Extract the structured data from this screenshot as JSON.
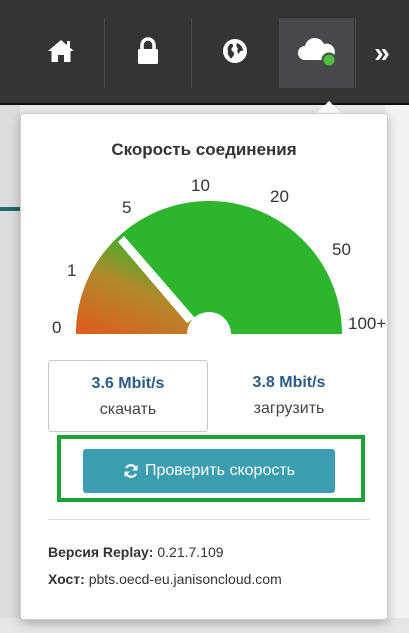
{
  "toolbar": {
    "items": [
      {
        "icon": "home-icon",
        "active": false
      },
      {
        "icon": "lock-icon",
        "active": false
      },
      {
        "icon": "globe-icon",
        "active": false
      },
      {
        "icon": "cloud-status-icon",
        "active": true
      },
      {
        "icon": "double-chevron-right-icon",
        "label": "»",
        "active": false
      }
    ]
  },
  "popup": {
    "title": "Скорость соединения",
    "gauge": {
      "ticks": [
        "0",
        "1",
        "5",
        "10",
        "20",
        "50",
        "100+"
      ],
      "needle_tick_value": 3.6,
      "colors": {
        "fill": "#2db52d",
        "gradient_start": "#e05a1c",
        "needle": "#ffffff"
      }
    },
    "download": {
      "value": "3.6 Mbit/s",
      "label": "скачать"
    },
    "upload": {
      "value": "3.8 Mbit/s",
      "label": "загрузить"
    },
    "check_button": {
      "label": "Проверить скорость",
      "icon": "refresh-icon"
    },
    "info": {
      "version_label": "Версия Replay:",
      "version_value": "0.21.7.109",
      "host_label": "Хост:",
      "host_value": "pbts.oecd-eu.janisoncloud.com"
    }
  },
  "colors": {
    "toolbar_bg": "#333436",
    "accent_button": "#3a9db0",
    "value_text": "#2a5d86",
    "highlight_border": "#19a337",
    "status_dot": "#4bbf3a"
  }
}
